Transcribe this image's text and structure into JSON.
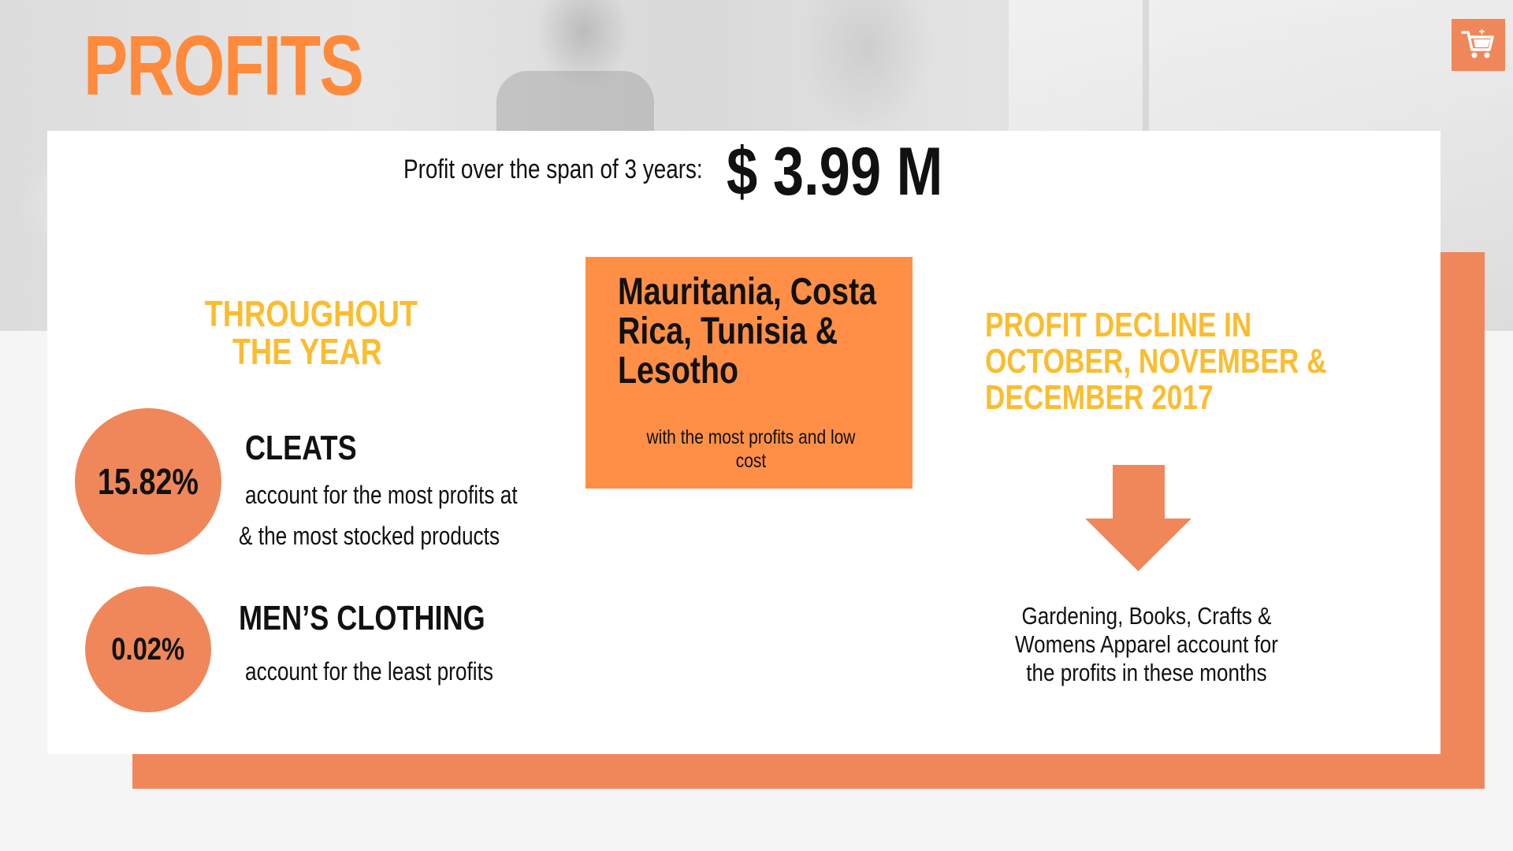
{
  "header": {
    "title": "PROFITS"
  },
  "icons": {
    "cart": "shopping-cart-icon",
    "arrow": "down-arrow-icon"
  },
  "summary": {
    "label": "Profit over the span of 3 years:",
    "value": "$ 3.99 M"
  },
  "left_section": {
    "heading_line1": "THROUGHOUT",
    "heading_line2": "THE YEAR",
    "cleats": {
      "percent": "15.82%",
      "title": "CLEATS",
      "desc_line1": "account for the most profits at",
      "desc_line2": "& the most stocked products"
    },
    "mens": {
      "percent": "0.02%",
      "title": "MEN’S CLOTHING",
      "desc": "account for the least profits"
    }
  },
  "center_section": {
    "countries_line1": "Mauritania, Costa",
    "countries_line2": "Rica, Tunisia &",
    "countries_line3": "Lesotho",
    "subtitle": "with the most profits and low cost"
  },
  "right_section": {
    "heading_line1": "PROFIT DECLINE IN",
    "heading_line2": "OCTOBER, NOVEMBER &",
    "heading_line3": "DECEMBER 2017",
    "desc": "Gardening, Books, Crafts & Womens Apparel account for the profits in these months"
  },
  "colors": {
    "accent_orange": "#ff8a3c",
    "panel_orange": "#f0875a",
    "box_orange": "#ff8f47",
    "heading_yellow": "#fbbd2f",
    "text": "#111111"
  }
}
